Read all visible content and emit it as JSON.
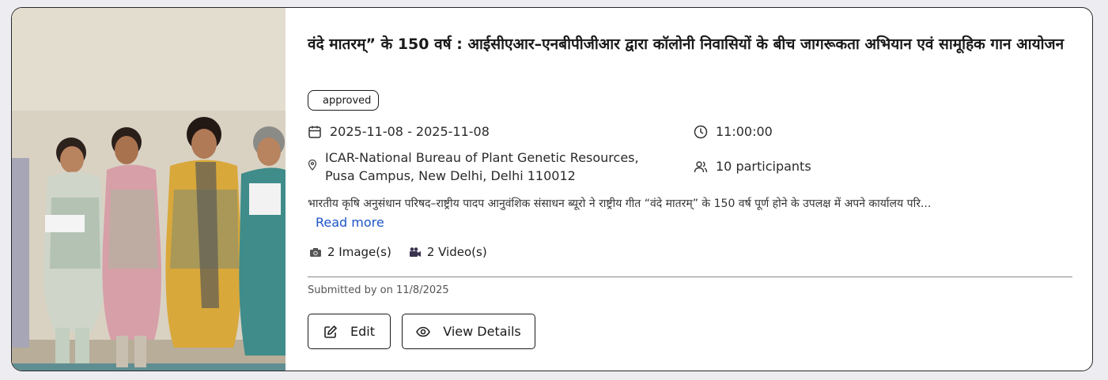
{
  "event": {
    "title": "वंदे मातरम्” के 150 वर्ष : आईसीएआर–एनबीपीजीआर द्वारा कॉलोनी निवासियों के बीच जागरूकता अभियान एवं सामूहिक गान आयोजन",
    "status": "approved",
    "date_range": "2025-11-08 - 2025-11-08",
    "time": "11:00:00",
    "location": "ICAR-National Bureau of Plant Genetic Resources, Pusa Campus, New Delhi, Delhi 110012",
    "participants": "10 participants",
    "description": "भारतीय कृषि अनुसंधान परिषद–राष्ट्रीय पादप आनुवंशिक संसाधन ब्यूरो ने राष्ट्रीय गीत “वंदे मातरम्” के 150 वर्ष पूर्ण होने के उपलक्ष में अपने कार्यालय परि...",
    "read_more": "Read more",
    "images": "2 Image(s)",
    "videos": "2 Video(s)",
    "submitted": "Submitted by on 11/8/2025"
  },
  "actions": {
    "edit_label": "Edit",
    "view_label": "View Details"
  },
  "icons": {
    "date": "calendar-icon",
    "time": "clock-icon",
    "location": "map-pin-icon",
    "participants": "users-icon",
    "images": "camera-icon",
    "videos": "video-camera-icon",
    "edit": "pencil-square-icon",
    "view": "eye-icon"
  },
  "colors": {
    "link": "#1d55c7",
    "border": "#1a1a1a",
    "background": "#ececf1"
  }
}
